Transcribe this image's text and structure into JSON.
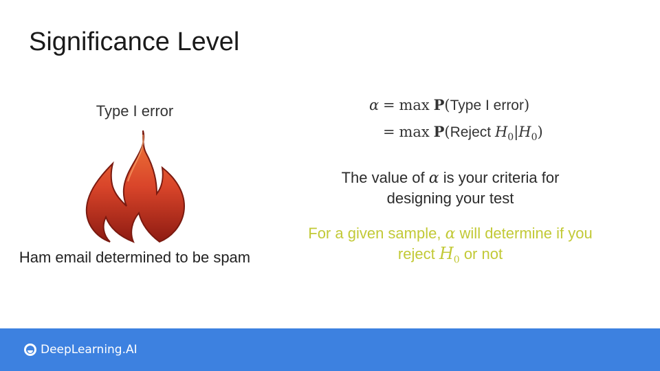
{
  "slide": {
    "title": "Significance Level",
    "left": {
      "heading": "Type I error",
      "icon": "fire-icon",
      "caption": "Ham email determined to be spam"
    },
    "formula": {
      "line1": {
        "alpha": "α",
        "eq": "=",
        "max": "max",
        "P": "P",
        "open": "(",
        "text": "Type I error",
        "close": ")"
      },
      "line2": {
        "eq": "=",
        "max": "max",
        "P": "P",
        "open": "(",
        "text": "Reject ",
        "H": "H",
        "sub": "0",
        "bar": "|",
        "H2": "H",
        "sub2": "0",
        "close": ")"
      }
    },
    "criteria": {
      "before": "The value of ",
      "alpha": "α",
      "after": " is your criteria for",
      "line2": "designing your test"
    },
    "sample": {
      "before": "For a given sample, ",
      "alpha": "α",
      "after": " will determine if you",
      "line2_before": "reject ",
      "H": "H",
      "sub": "0",
      "line2_after": " or not"
    }
  },
  "footer": {
    "brand": "DeepLearning.AI",
    "logo_icon": "deeplearning-logo-icon"
  },
  "colors": {
    "footer_bg": "#3d81e0",
    "highlight_text": "#c2c936",
    "flame_outer": "#e8602c",
    "flame_inner": "#8e1b12"
  }
}
